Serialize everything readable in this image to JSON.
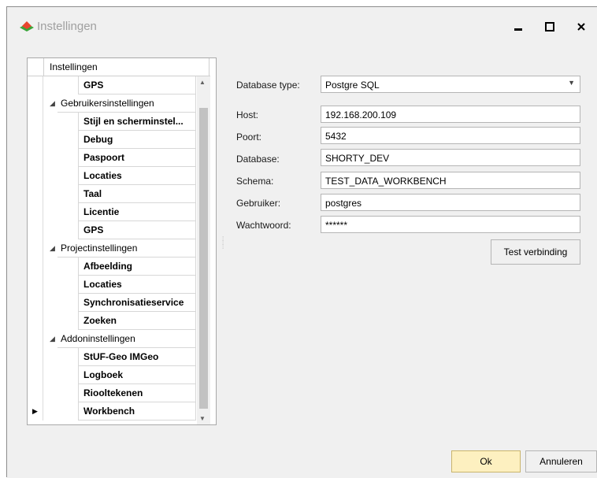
{
  "window": {
    "title": "Instellingen"
  },
  "tree": {
    "header": "Instellingen",
    "rows": [
      {
        "label": "GPS",
        "level": 1
      },
      {
        "label": "Gebruikersinstellingen",
        "level": 0,
        "expanded": true
      },
      {
        "label": "Stijl en scherminstel...",
        "level": 1
      },
      {
        "label": "Debug",
        "level": 1
      },
      {
        "label": "Paspoort",
        "level": 1
      },
      {
        "label": "Locaties",
        "level": 1
      },
      {
        "label": "Taal",
        "level": 1
      },
      {
        "label": "Licentie",
        "level": 1
      },
      {
        "label": "GPS",
        "level": 1
      },
      {
        "label": "Projectinstellingen",
        "level": 0,
        "expanded": true
      },
      {
        "label": "Afbeelding",
        "level": 1
      },
      {
        "label": "Locaties",
        "level": 1
      },
      {
        "label": "Synchronisatieservice",
        "level": 1
      },
      {
        "label": "Zoeken",
        "level": 1
      },
      {
        "label": "Addoninstellingen",
        "level": 0,
        "expanded": true
      },
      {
        "label": "StUF-Geo IMGeo",
        "level": 1
      },
      {
        "label": "Logboek",
        "level": 1
      },
      {
        "label": "Riooltekenen",
        "level": 1
      },
      {
        "label": "Workbench",
        "level": 1,
        "current": true
      }
    ]
  },
  "form": {
    "db_type_label": "Database type:",
    "db_type_value": "Postgre SQL",
    "host_label": "Host:",
    "host_value": "192.168.200.109",
    "port_label": "Poort:",
    "port_value": "5432",
    "database_label": "Database:",
    "database_value": "SHORTY_DEV",
    "schema_label": "Schema:",
    "schema_value": "TEST_DATA_WORKBENCH",
    "user_label": "Gebruiker:",
    "user_value": "postgres",
    "password_label": "Wachtwoord:",
    "password_value": "******",
    "test_button": "Test verbinding"
  },
  "footer": {
    "ok": "Ok",
    "cancel": "Annuleren"
  },
  "colors": {
    "ok_button": "#fdf0c0",
    "title_text": "#a0a0a0",
    "icon_red": "#e8452e",
    "icon_green": "#3aa53a"
  }
}
